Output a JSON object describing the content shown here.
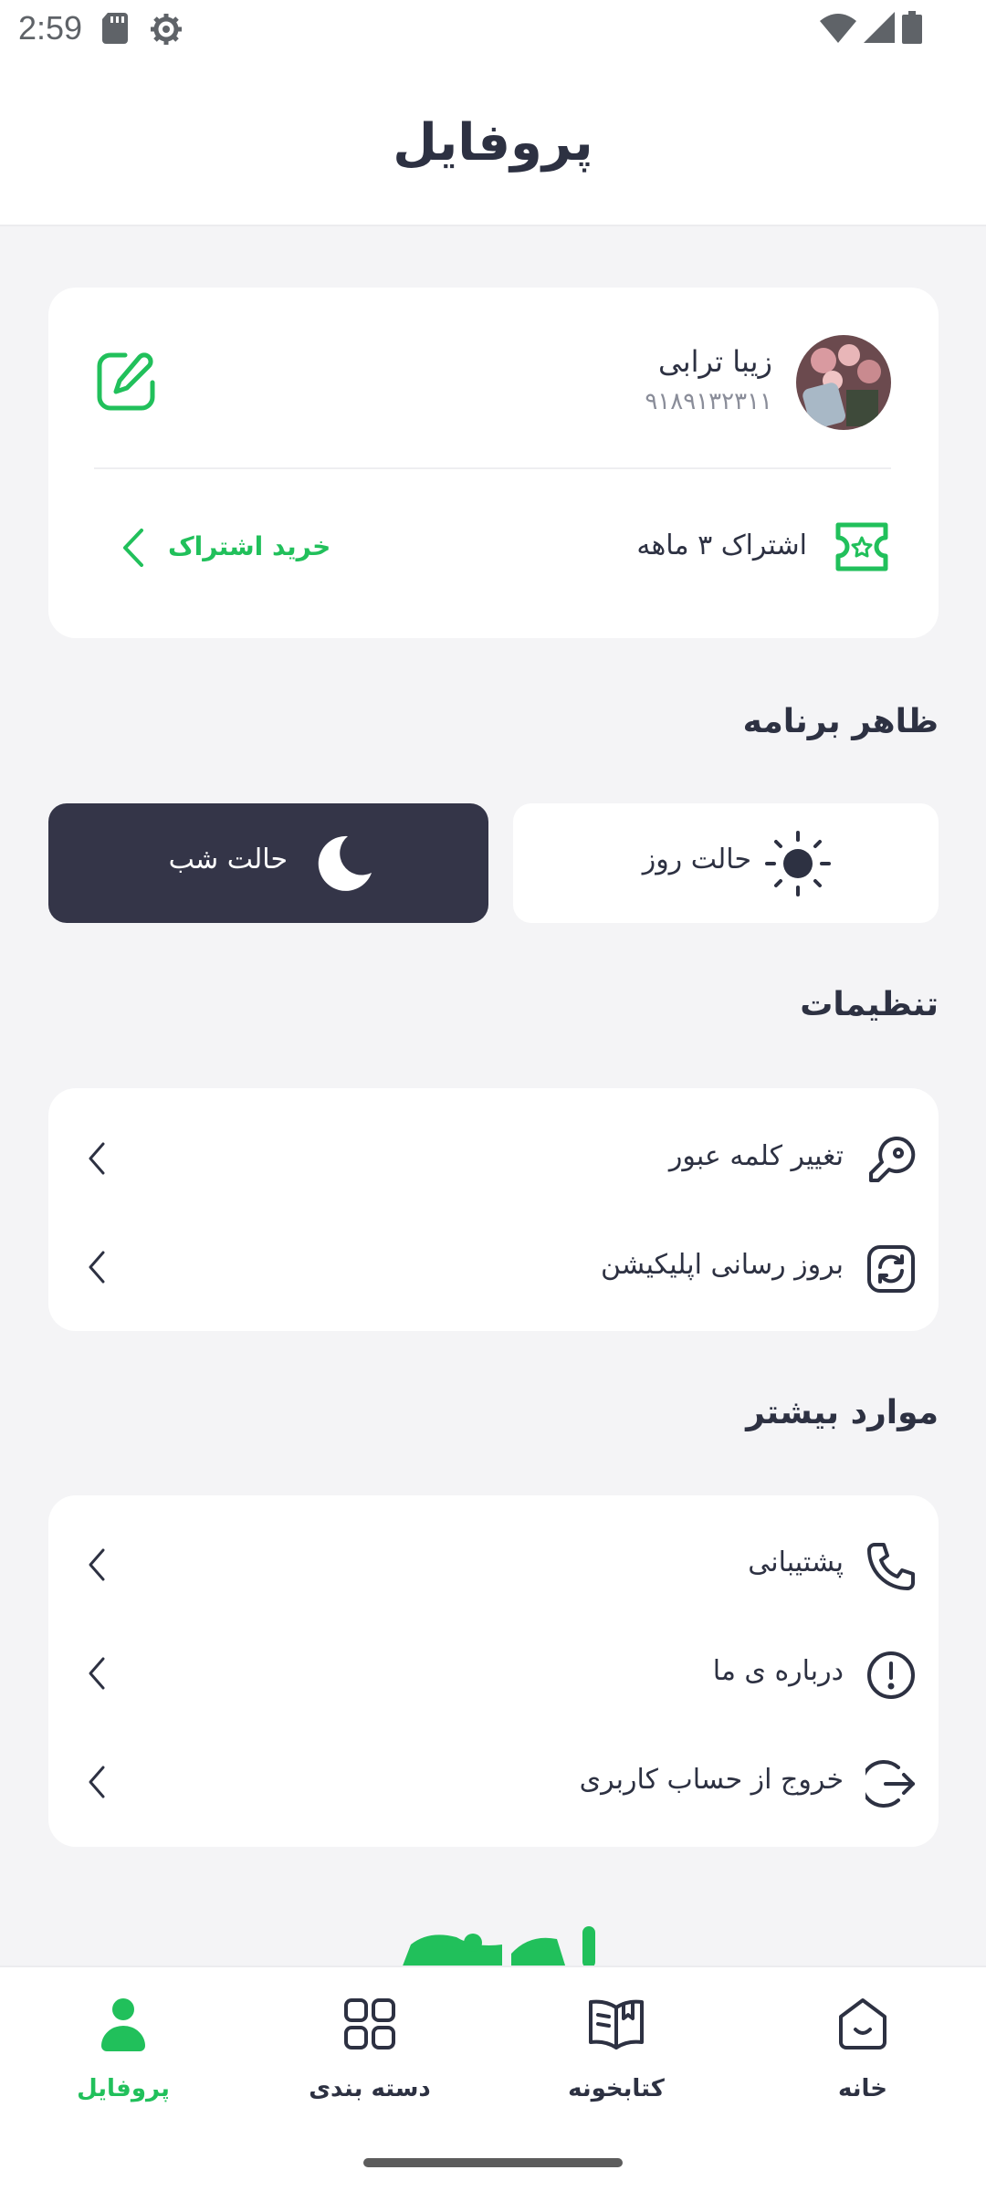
{
  "status_bar": {
    "time": "2:59"
  },
  "header": {
    "title": "پروفایل"
  },
  "profile": {
    "name": "زیبا ترابی",
    "phone": "۹۱۸۹۱۳۲۳۱۱",
    "subscription_label": "اشتراک ۳ ماهه",
    "buy_subscription_label": "خرید اشتراک"
  },
  "appearance": {
    "title": "ظاهر برنامه",
    "day_mode_label": "حالت روز",
    "night_mode_label": "حالت شب",
    "selected": "night"
  },
  "settings": {
    "title": "تنظیمات",
    "items": [
      {
        "label": "تغییر کلمه عبور",
        "icon": "key-icon"
      },
      {
        "label": "بروز رسانی اپلیکیشن",
        "icon": "refresh-icon"
      }
    ]
  },
  "more": {
    "title": "موارد بیشتر",
    "items": [
      {
        "label": "پشتیبانی",
        "icon": "phone-icon"
      },
      {
        "label": "درباره ی ما",
        "icon": "info-icon"
      },
      {
        "label": "خروج از حساب کاربری",
        "icon": "logout-icon"
      }
    ]
  },
  "bottom_nav": {
    "items": [
      {
        "label": "خانه",
        "icon": "home-icon",
        "active": false
      },
      {
        "label": "کتابخونه",
        "icon": "book-icon",
        "active": false
      },
      {
        "label": "دسته بندی",
        "icon": "grid-icon",
        "active": false
      },
      {
        "label": "پروفایل",
        "icon": "profile-icon",
        "active": true
      }
    ]
  },
  "colors": {
    "accent": "#21c05b",
    "dark": "#343548",
    "text": "#2d3142",
    "background": "#f4f4f6"
  }
}
